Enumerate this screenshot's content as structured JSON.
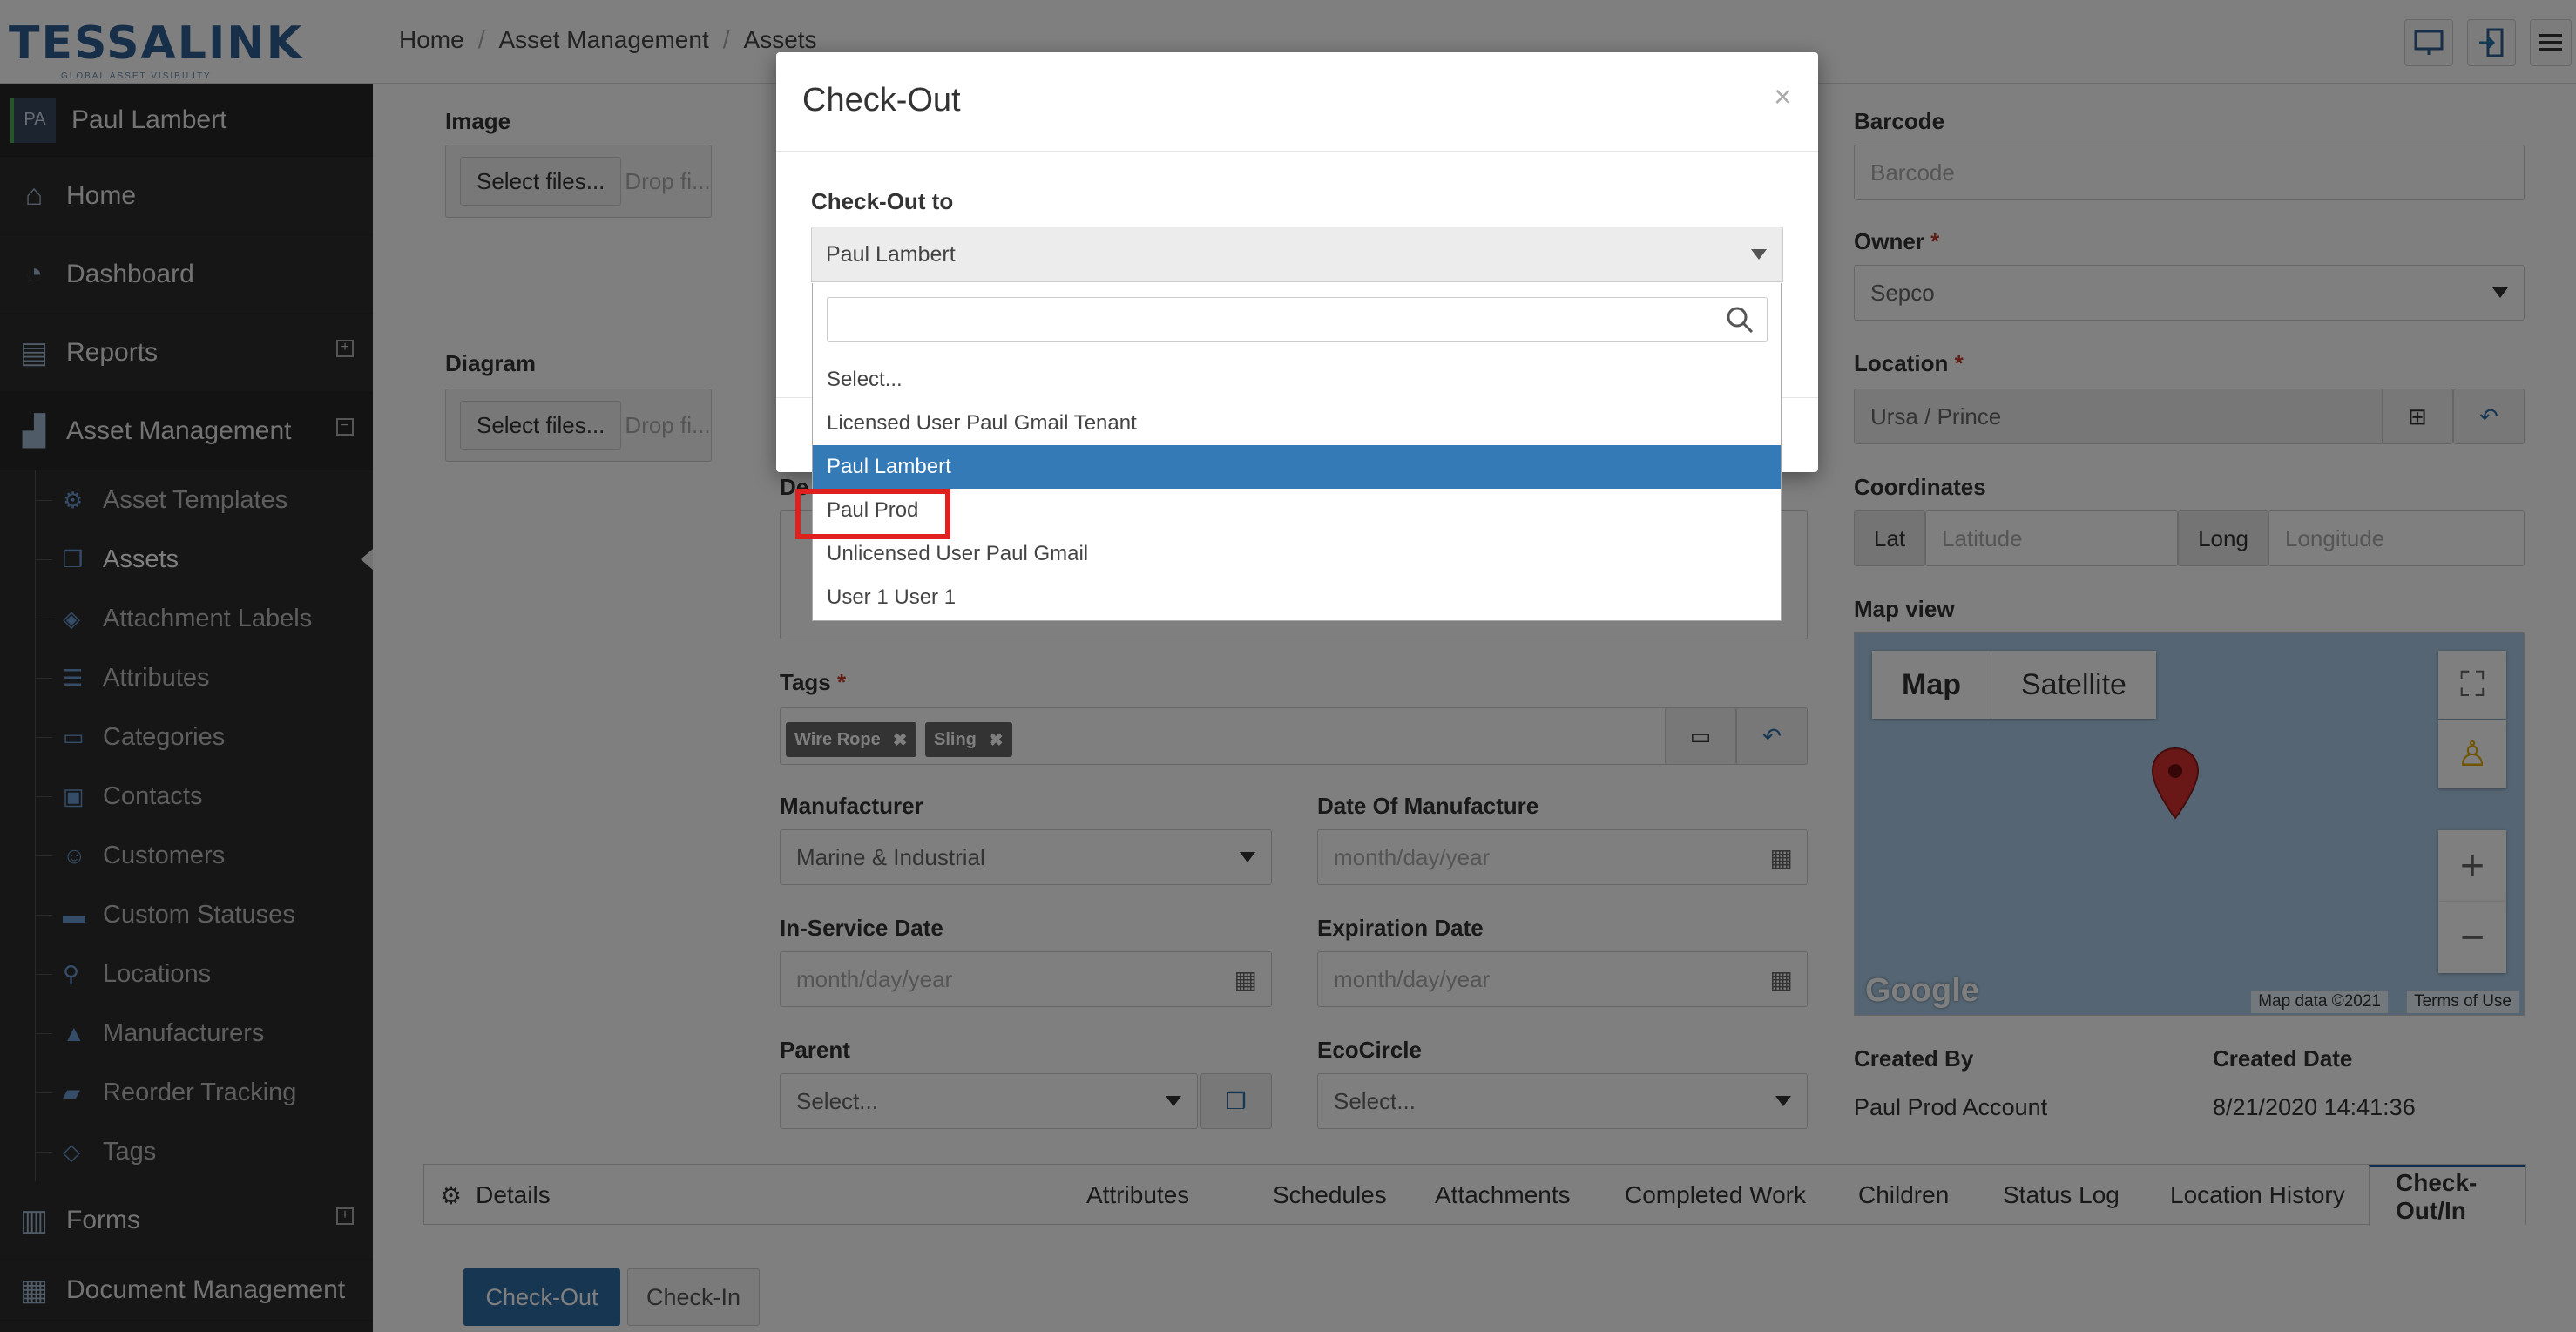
{
  "header": {
    "logo_text": "TESSALINK",
    "logo_sub": "GLOBAL ASSET VISIBILITY",
    "breadcrumb": [
      "Home",
      "Asset Management",
      "Assets"
    ]
  },
  "sidebar": {
    "user_initials": "PA",
    "user_name": "Paul Lambert",
    "main_items": [
      {
        "label": "Home",
        "icon": "home-icon"
      },
      {
        "label": "Dashboard",
        "icon": "dashboard-icon"
      },
      {
        "label": "Reports",
        "icon": "reports-icon"
      },
      {
        "label": "Asset Management",
        "icon": "factory-icon"
      },
      {
        "label": "Forms",
        "icon": "clipboard-icon"
      },
      {
        "label": "Document Management",
        "icon": "document-icon"
      }
    ],
    "sub_items": [
      "Asset Templates",
      "Assets",
      "Attachment Labels",
      "Attributes",
      "Categories",
      "Contacts",
      "Customers",
      "Custom Statuses",
      "Locations",
      "Manufacturers",
      "Reorder Tracking",
      "Tags"
    ]
  },
  "form": {
    "image_label": "Image",
    "diagram_label": "Diagram",
    "select_files": "Select files...",
    "drop_files": "Drop fi...",
    "description_label": "De",
    "tags_label": "Tags",
    "tags": [
      "Wire Rope",
      "Sling"
    ],
    "manufacturer_label": "Manufacturer",
    "manufacturer_value": "Marine & Industrial",
    "date_of_manufacture_label": "Date Of Manufacture",
    "inservice_label": "In-Service Date",
    "expiration_label": "Expiration Date",
    "date_placeholder": "month/day/year",
    "parent_label": "Parent",
    "parent_value": "Select...",
    "ecocircle_label": "EcoCircle",
    "ecocircle_value": "Select...",
    "barcode_label": "Barcode",
    "barcode_placeholder": "Barcode",
    "owner_label": "Owner",
    "owner_value": "Sepco",
    "location_label": "Location",
    "location_value": "Ursa / Prince",
    "coordinates_label": "Coordinates",
    "lat_label": "Lat",
    "lat_placeholder": "Latitude",
    "long_label": "Long",
    "long_placeholder": "Longitude",
    "map_view_label": "Map view",
    "created_by_label": "Created By",
    "created_by_value": "Paul Prod Account",
    "created_date_label": "Created Date",
    "created_date_value": "8/21/2020 14:41:36",
    "required_mark": "*"
  },
  "map": {
    "map_btn": "Map",
    "satellite_btn": "Satellite",
    "google_logo": "Google",
    "map_data": "Map data ©2021",
    "terms": "Terms of Use"
  },
  "tabs": {
    "details": "Details",
    "items": [
      "Attributes",
      "Schedules",
      "Attachments",
      "Completed Work",
      "Children",
      "Status Log",
      "Location History",
      "Check-Out/In"
    ],
    "checkout_btn": "Check-Out",
    "checkin_btn": "Check-In"
  },
  "modal": {
    "title": "Check-Out",
    "close": "×",
    "checkout_to_label": "Check-Out to",
    "selected_value": "Paul Lambert",
    "search_value": "",
    "options": [
      "Select...",
      "Licensed User Paul Gmail Tenant",
      "Paul Lambert",
      "Paul Prod",
      "Unlicensed User Paul Gmail",
      "User 1 User 1"
    ],
    "selected_index": 2
  },
  "colors": {
    "sidebar_bg": "#2d2d2d",
    "primary": "#337ab7",
    "highlight": "#e0201f"
  }
}
